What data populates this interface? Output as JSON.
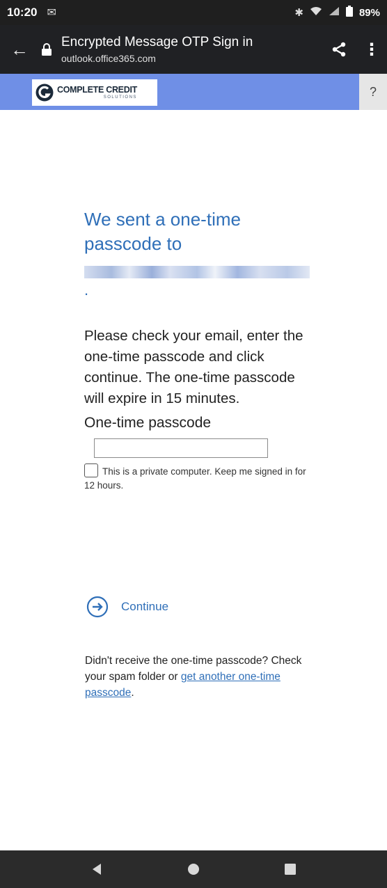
{
  "status_bar": {
    "time": "10:20",
    "battery": "89%"
  },
  "browser": {
    "page_title": "Encrypted Message OTP Sign in",
    "url": "outlook.office365.com"
  },
  "banner": {
    "logo_text": "COMPLETE CREDIT",
    "logo_subtext": "SOLUTIONS",
    "help_label": "?"
  },
  "main": {
    "heading": "We sent a one-time passcode to",
    "heading_trailing": ".",
    "instructions": "Please check your email, enter the one-time passcode and click continue. The one-time passcode will expire in 15 minutes.",
    "passcode_label": "One-time passcode",
    "passcode_value": "",
    "remember_label": "This is a private computer. Keep me signed in for 12 hours.",
    "continue_label": "Continue",
    "footer_text": "Didn't receive the one-time passcode? Check your spam folder or ",
    "footer_link": "get another one-time passcode",
    "footer_end": "."
  },
  "colors": {
    "accent": "#2f6fb8",
    "banner": "#6f8fe6",
    "toolbar": "#202124"
  }
}
